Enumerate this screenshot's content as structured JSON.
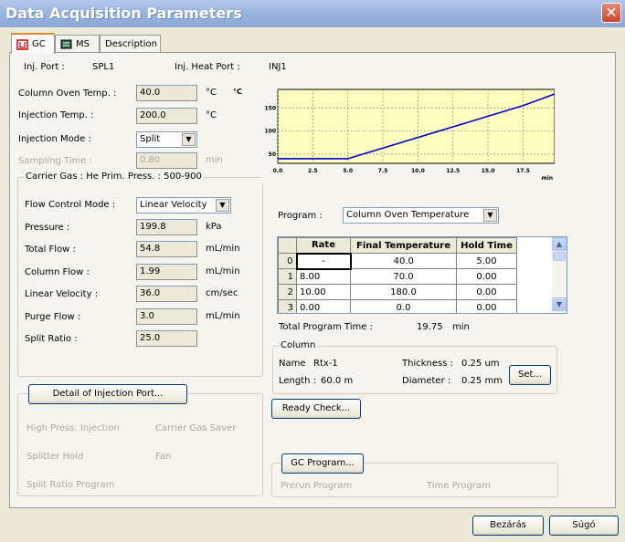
{
  "window": {
    "title": "Data Acquisition Parameters",
    "close_label": "✕"
  },
  "tabs": [
    {
      "label": "GC"
    },
    {
      "label": "MS"
    },
    {
      "label": "Description"
    }
  ],
  "inj": {
    "port_label": "Inj. Port :",
    "port_value": "SPL1",
    "heat_port_label": "Inj. Heat Port :",
    "heat_port_value": "INJ1"
  },
  "params": {
    "column_oven_temp": {
      "label": "Column Oven Temp. :",
      "value": "40.0",
      "unit": "°C",
      "unit2": "°C"
    },
    "injection_temp": {
      "label": "Injection Temp. :",
      "value": "200.0",
      "unit": "°C"
    },
    "injection_mode": {
      "label": "Injection Mode :",
      "value": "Split"
    },
    "sampling_time": {
      "label": "Sampling Time :",
      "value": "0.80",
      "unit": "min"
    }
  },
  "carrier": {
    "group_label": "Carrier Gas : He     Prim. Press. : 500-900",
    "flow_control_mode": {
      "label": "Flow Control Mode :",
      "value": "Linear Velocity"
    },
    "pressure": {
      "label": "Pressure :",
      "value": "199.8",
      "unit": "kPa"
    },
    "total_flow": {
      "label": "Total Flow :",
      "value": "54.8",
      "unit": "mL/min"
    },
    "column_flow": {
      "label": "Column Flow :",
      "value": "1.99",
      "unit": "mL/min"
    },
    "linear_velocity": {
      "label": "Linear Velocity :",
      "value": "36.0",
      "unit": "cm/sec"
    },
    "purge_flow": {
      "label": "Purge Flow :",
      "value": "3.0",
      "unit": "mL/min"
    },
    "split_ratio": {
      "label": "Split Ratio :",
      "value": "25.0"
    }
  },
  "injection_port": {
    "detail_button": "Detail of Injection Port...",
    "high_press": "High Press. Injection",
    "carrier_gas_saver": "Carrier Gas Saver",
    "splitter_hold": "Splitter Hold",
    "fan": "Fan",
    "split_ratio_program": "Split Ratio Program"
  },
  "chart_data": {
    "type": "line",
    "x": [
      0.0,
      5.0,
      17.5,
      19.75
    ],
    "series": [
      {
        "values": [
          40,
          40,
          155,
          180
        ]
      }
    ],
    "x_ticks": [
      "0.0",
      "2.5",
      "5.0",
      "7.5",
      "10.0",
      "12.5",
      "15.0",
      "17.5"
    ],
    "y_ticks": [
      "150",
      "100",
      "50"
    ],
    "xlabel": "min",
    "xlim": [
      0,
      19.75
    ],
    "ylim": [
      30,
      190
    ],
    "grid": true,
    "line_color": "#0000cc"
  },
  "program": {
    "label": "Program :",
    "value": "Column Oven Temperature",
    "headers": [
      "",
      "Rate",
      "Final Temperature",
      "Hold Time"
    ],
    "rows": [
      [
        "0",
        "-",
        "40.0",
        "5.00"
      ],
      [
        "1",
        "8.00",
        "70.0",
        "0.00"
      ],
      [
        "2",
        "10.00",
        "180.0",
        "0.00"
      ],
      [
        "3",
        "0.00",
        "0.0",
        "0.00"
      ]
    ],
    "total_label": "Total Program Time :",
    "total_value": "19.75",
    "total_unit": "min"
  },
  "column": {
    "group_label": "Column",
    "name_label": "Name",
    "name_value": "Rtx-1",
    "length_label": "Length :",
    "length_value": "60.0 m",
    "thickness_label": "Thickness :",
    "thickness_value": "0.25 um",
    "diameter_label": "Diameter :",
    "diameter_value": "0.25 mm",
    "set_button": "Set..."
  },
  "ready_check_button": "Ready Check...",
  "gc_program": {
    "button": "GC Program...",
    "prerun": "Prerun Program",
    "time_program": "Time Program"
  },
  "footer": {
    "close_button": "Bezárás",
    "help_button": "Súgó"
  }
}
